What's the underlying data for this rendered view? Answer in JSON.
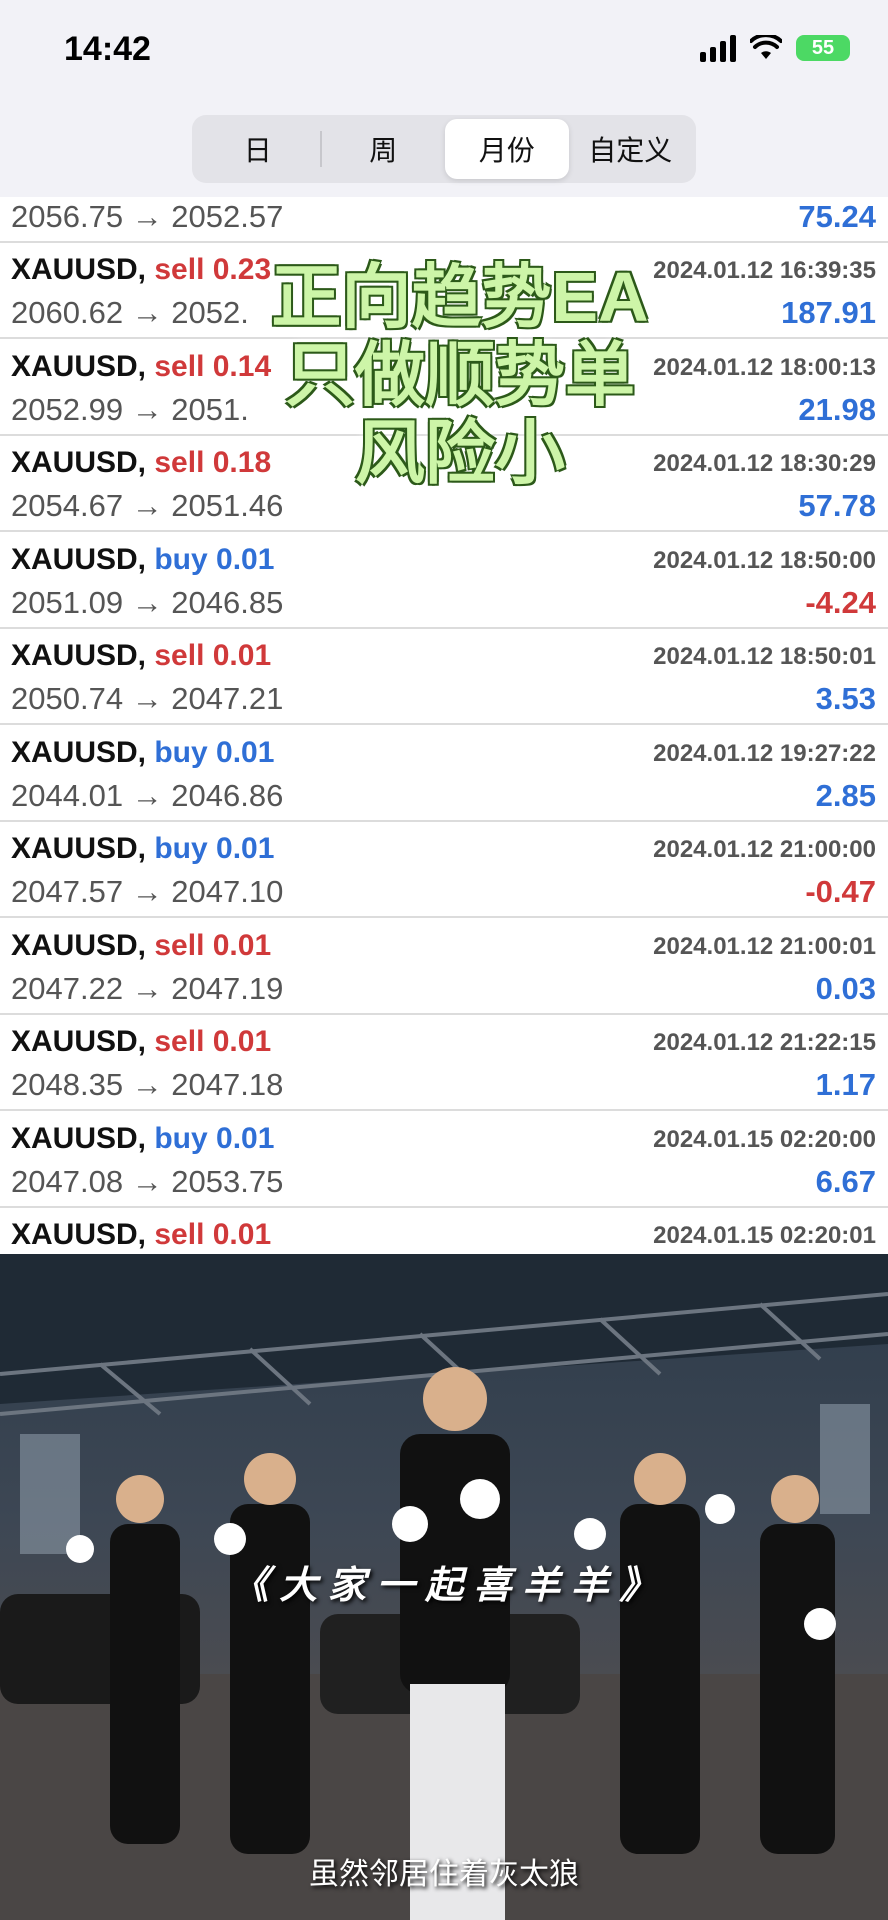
{
  "status_bar": {
    "time": "14:42",
    "battery": "55"
  },
  "segments": [
    {
      "label": "日",
      "active": false
    },
    {
      "label": "周",
      "active": false
    },
    {
      "label": "月份",
      "active": true
    },
    {
      "label": "自定义",
      "active": false
    }
  ],
  "partial_row": {
    "prices": "2056.75 → 2052.57",
    "profit": "75.24"
  },
  "trades": [
    {
      "symbol": "XAUUSD,",
      "side": "sell 0.23",
      "type": "sell",
      "datetime": "2024.01.12 16:39:35",
      "prices": "2060.62 → 2052.",
      "profit": "187.91",
      "sign": "pos"
    },
    {
      "symbol": "XAUUSD,",
      "side": "sell 0.14",
      "type": "sell",
      "datetime": "2024.01.12 18:00:13",
      "prices": "2052.99 → 2051.",
      "profit": "21.98",
      "sign": "pos"
    },
    {
      "symbol": "XAUUSD,",
      "side": "sell 0.18",
      "type": "sell",
      "datetime": "2024.01.12 18:30:29",
      "prices": "2054.67 → 2051.46",
      "profit": "57.78",
      "sign": "pos"
    },
    {
      "symbol": "XAUUSD,",
      "side": "buy 0.01",
      "type": "buy",
      "datetime": "2024.01.12 18:50:00",
      "prices": "2051.09 → 2046.85",
      "profit": "-4.24",
      "sign": "neg"
    },
    {
      "symbol": "XAUUSD,",
      "side": "sell 0.01",
      "type": "sell",
      "datetime": "2024.01.12 18:50:01",
      "prices": "2050.74 → 2047.21",
      "profit": "3.53",
      "sign": "pos"
    },
    {
      "symbol": "XAUUSD,",
      "side": "buy 0.01",
      "type": "buy",
      "datetime": "2024.01.12 19:27:22",
      "prices": "2044.01 → 2046.86",
      "profit": "2.85",
      "sign": "pos"
    },
    {
      "symbol": "XAUUSD,",
      "side": "buy 0.01",
      "type": "buy",
      "datetime": "2024.01.12 21:00:00",
      "prices": "2047.57 → 2047.10",
      "profit": "-0.47",
      "sign": "neg"
    },
    {
      "symbol": "XAUUSD,",
      "side": "sell 0.01",
      "type": "sell",
      "datetime": "2024.01.12 21:00:01",
      "prices": "2047.22 → 2047.19",
      "profit": "0.03",
      "sign": "pos"
    },
    {
      "symbol": "XAUUSD,",
      "side": "sell 0.01",
      "type": "sell",
      "datetime": "2024.01.12 21:22:15",
      "prices": "2048.35 → 2047.18",
      "profit": "1.17",
      "sign": "pos"
    },
    {
      "symbol": "XAUUSD,",
      "side": "buy 0.01",
      "type": "buy",
      "datetime": "2024.01.15 02:20:00",
      "prices": "2047.08 → 2053.75",
      "profit": "6.67",
      "sign": "pos"
    },
    {
      "symbol": "XAUUSD,",
      "side": "sell 0.01",
      "type": "sell",
      "datetime": "2024.01.15 02:20:01",
      "prices": "",
      "profit": "",
      "sign": "pos"
    }
  ],
  "overlay_lines": [
    "正向趋势EA",
    "只做顺势单",
    "风险小"
  ],
  "video": {
    "caption_top": "《 大 家 一 起 喜 羊 羊 》",
    "caption_bottom": "虽然邻居住着灰太狼"
  },
  "colors": {
    "sell": "#d0393a",
    "buy": "#2f6fd6",
    "profit_pos": "#2f6fd6",
    "profit_neg": "#d0393a"
  }
}
